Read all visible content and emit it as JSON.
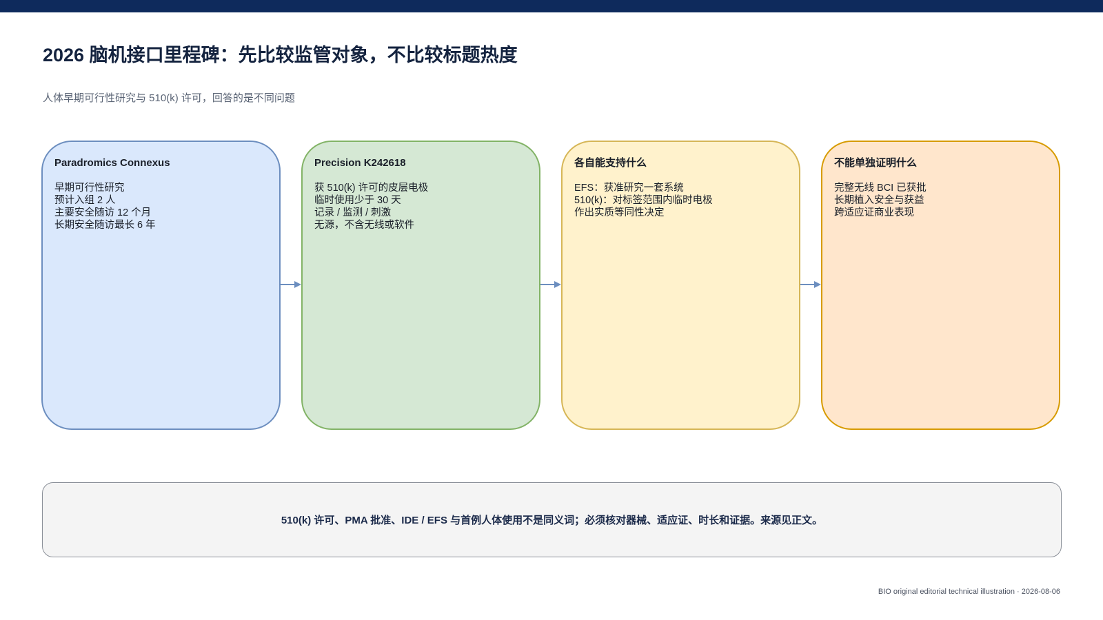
{
  "title": "2026 脑机接口里程碑：先比较监管对象，不比较标题热度",
  "subtitle": "人体早期可行性研究与 510(k) 许可，回答的是不同问题",
  "cards": [
    {
      "title": "Paradromics Connexus",
      "lines": [
        "早期可行性研究",
        "预计入组 2 人",
        "主要安全随访 12 个月",
        "长期安全随访最长 6 年"
      ],
      "fill": "#dae8fc",
      "border": "#6c8ebf"
    },
    {
      "title": "Precision K242618",
      "lines": [
        "获 510(k) 许可的皮层电极",
        "临时使用少于 30 天",
        "记录 / 监测 / 刺激",
        "无源，不含无线或软件"
      ],
      "fill": "#d5e8d4",
      "border": "#82b366"
    },
    {
      "title": "各自能支持什么",
      "lines": [
        "EFS：获准研究一套系统",
        "510(k)：对标签范围内临时电极",
        "作出实质等同性决定"
      ],
      "fill": "#fff2cc",
      "border": "#d6b656"
    },
    {
      "title": "不能单独证明什么",
      "lines": [
        "完整无线 BCI 已获批",
        "长期植入安全与获益",
        "跨适应证商业表现"
      ],
      "fill": "#ffe6cc",
      "border": "#d79b00"
    }
  ],
  "connector_color": "#6c8ebf",
  "note": "510(k) 许可、PMA 批准、IDE / EFS 与首例人体使用不是同义词；必须核对器械、适应证、时长和证据。来源见正文。",
  "footer": "BIO original editorial technical illustration · 2026-08-06"
}
